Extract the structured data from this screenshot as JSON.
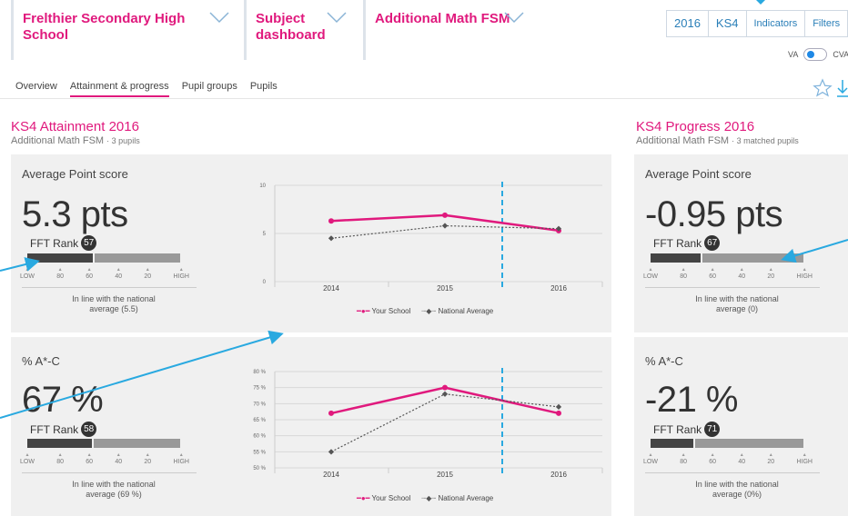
{
  "header": {
    "school": "Frelthier Secondary High School",
    "dashboard": "Subject dashboard",
    "subject": "Additional Math FSM",
    "filters": [
      "2016",
      "KS4",
      "Indicators",
      "Filters"
    ],
    "toggle_left": "VA",
    "toggle_right": "CVA"
  },
  "tabs": [
    "Overview",
    "Attainment & progress",
    "Pupil groups",
    "Pupils"
  ],
  "attainment": {
    "title": "KS4 Attainment 2016",
    "subtitle": "Additional Math FSM",
    "subtitle_count": "· 3 pupils",
    "aps": {
      "label": "Average Point score",
      "value": "5.3 pts",
      "rank_label": "FFT Rank",
      "rank": "57",
      "rank_fraction": 0.43,
      "note": "In line with the national average (5.5)"
    },
    "pct": {
      "label": "% A*-C",
      "value": "67 %",
      "rank_label": "FFT Rank",
      "rank": "58",
      "rank_fraction": 0.42,
      "note": "In line with the national average (69 %)"
    }
  },
  "progress": {
    "title": "KS4 Progress 2016",
    "subtitle": "Additional Math FSM",
    "subtitle_count": "· 3 matched pupils",
    "aps": {
      "label": "Average Point score",
      "value": "-0.95 pts",
      "rank_label": "FFT Rank",
      "rank": "67",
      "rank_fraction": 0.33,
      "note": "In line with the national average (0)"
    },
    "pct": {
      "label": "% A*-C",
      "value": "-21 %",
      "rank_label": "FFT Rank",
      "rank": "71",
      "rank_fraction": 0.28,
      "note": "In line with the national average (0%)"
    }
  },
  "rank_scale": [
    "LOW",
    "80",
    "60",
    "40",
    "20",
    "HIGH"
  ],
  "legend": {
    "school": "Your School",
    "national": "National Average"
  },
  "colors": {
    "school": "#e0197d",
    "national": "#555555",
    "marker": "#29a9e0"
  },
  "chart_data": [
    {
      "type": "line",
      "x": [
        "2014",
        "2015",
        "2016"
      ],
      "ylim": [
        0,
        10
      ],
      "yticks": [
        "0",
        "5",
        "10"
      ],
      "series": [
        {
          "name": "Your School",
          "values": [
            6.3,
            6.9,
            5.3
          ]
        },
        {
          "name": "National Average",
          "values": [
            4.5,
            5.8,
            5.5
          ]
        }
      ]
    },
    {
      "type": "line",
      "x": [
        "2014",
        "2015",
        "2016"
      ],
      "ylim": [
        50,
        80
      ],
      "yticks": [
        "50 %",
        "55 %",
        "60 %",
        "65 %",
        "70 %",
        "75 %",
        "80 %"
      ],
      "series": [
        {
          "name": "Your School",
          "values": [
            67,
            75,
            67
          ]
        },
        {
          "name": "National Average",
          "values": [
            55,
            73,
            69
          ]
        }
      ]
    }
  ]
}
